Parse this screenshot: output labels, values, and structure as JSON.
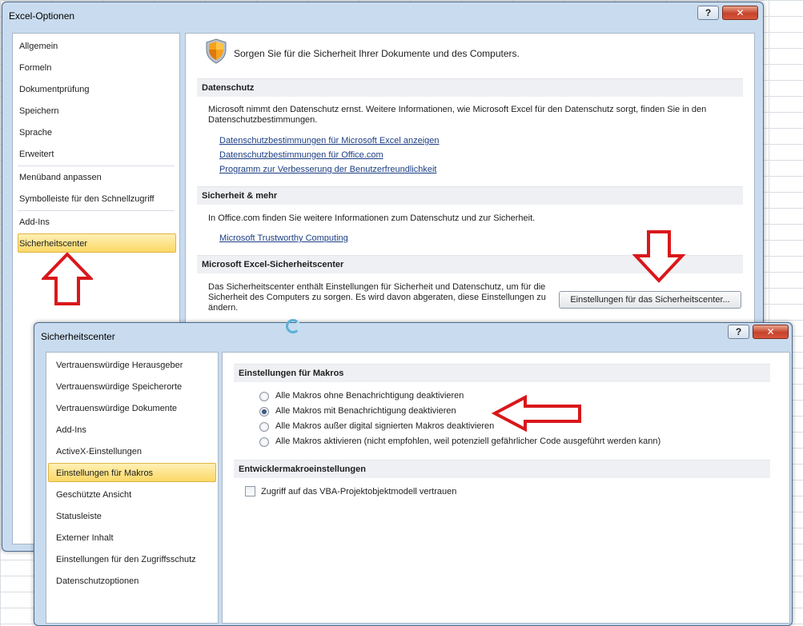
{
  "excel_options": {
    "title": "Excel-Optionen",
    "help_label": "?",
    "close_label": "✕",
    "nav": [
      {
        "label": "Allgemein"
      },
      {
        "label": "Formeln"
      },
      {
        "label": "Dokumentprüfung"
      },
      {
        "label": "Speichern"
      },
      {
        "label": "Sprache"
      },
      {
        "label": "Erweitert"
      },
      {
        "label": "Menüband anpassen"
      },
      {
        "label": "Symbolleiste für den Schnellzugriff"
      },
      {
        "label": "Add-Ins"
      },
      {
        "label": "Sicherheitscenter",
        "selected": true
      }
    ],
    "header": "Sorgen Sie für die Sicherheit Ihrer Dokumente und des Computers.",
    "datenschutz": {
      "heading": "Datenschutz",
      "text": "Microsoft nimmt den Datenschutz ernst. Weitere Informationen, wie Microsoft Excel für den Datenschutz sorgt, finden Sie in den Datenschutzbestimmungen.",
      "links": [
        "Datenschutzbestimmungen für Microsoft Excel anzeigen",
        "Datenschutzbestimmungen für Office.com",
        "Programm zur Verbesserung der Benutzerfreundlichkeit"
      ]
    },
    "sicherheit": {
      "heading": "Sicherheit & mehr",
      "text": "In Office.com finden Sie weitere Informationen zum Datenschutz und zur Sicherheit.",
      "link": "Microsoft Trustworthy Computing"
    },
    "trustcenter": {
      "heading": "Microsoft Excel-Sicherheitscenter",
      "text": "Das Sicherheitscenter enthält Einstellungen für Sicherheit und Datenschutz, um für die Sicherheit des Computers zu sorgen. Es wird davon abgeraten, diese Einstellungen zu ändern.",
      "button": "Einstellungen für das Sicherheitscenter..."
    }
  },
  "trust_center": {
    "title": "Sicherheitscenter",
    "help_label": "?",
    "close_label": "✕",
    "nav": [
      {
        "label": "Vertrauenswürdige Herausgeber"
      },
      {
        "label": "Vertrauenswürdige Speicherorte"
      },
      {
        "label": "Vertrauenswürdige Dokumente"
      },
      {
        "label": "Add-Ins"
      },
      {
        "label": "ActiveX-Einstellungen"
      },
      {
        "label": "Einstellungen für Makros",
        "selected": true
      },
      {
        "label": "Geschützte Ansicht"
      },
      {
        "label": "Statusleiste"
      },
      {
        "label": "Externer Inhalt"
      },
      {
        "label": "Einstellungen für den Zugriffsschutz"
      },
      {
        "label": "Datenschutzoptionen"
      }
    ],
    "macro_heading": "Einstellungen für Makros",
    "macro_options": [
      {
        "label": "Alle Makros ohne Benachrichtigung deaktivieren",
        "selected": false
      },
      {
        "label": "Alle Makros mit Benachrichtigung deaktivieren",
        "selected": true
      },
      {
        "label": "Alle Makros außer digital signierten Makros deaktivieren",
        "selected": false
      },
      {
        "label": "Alle Makros aktivieren (nicht empfohlen, weil potenziell gefährlicher Code ausgeführt werden kann)",
        "selected": false
      }
    ],
    "dev_heading": "Entwicklermakroeinstellungen",
    "dev_checkbox": {
      "label": "Zugriff auf das VBA-Projektobjektmodell vertrauen",
      "checked": false
    }
  },
  "colors": {
    "arrow_red": "#d9171b",
    "selection": "#fbd866",
    "link": "#1c3e84"
  }
}
